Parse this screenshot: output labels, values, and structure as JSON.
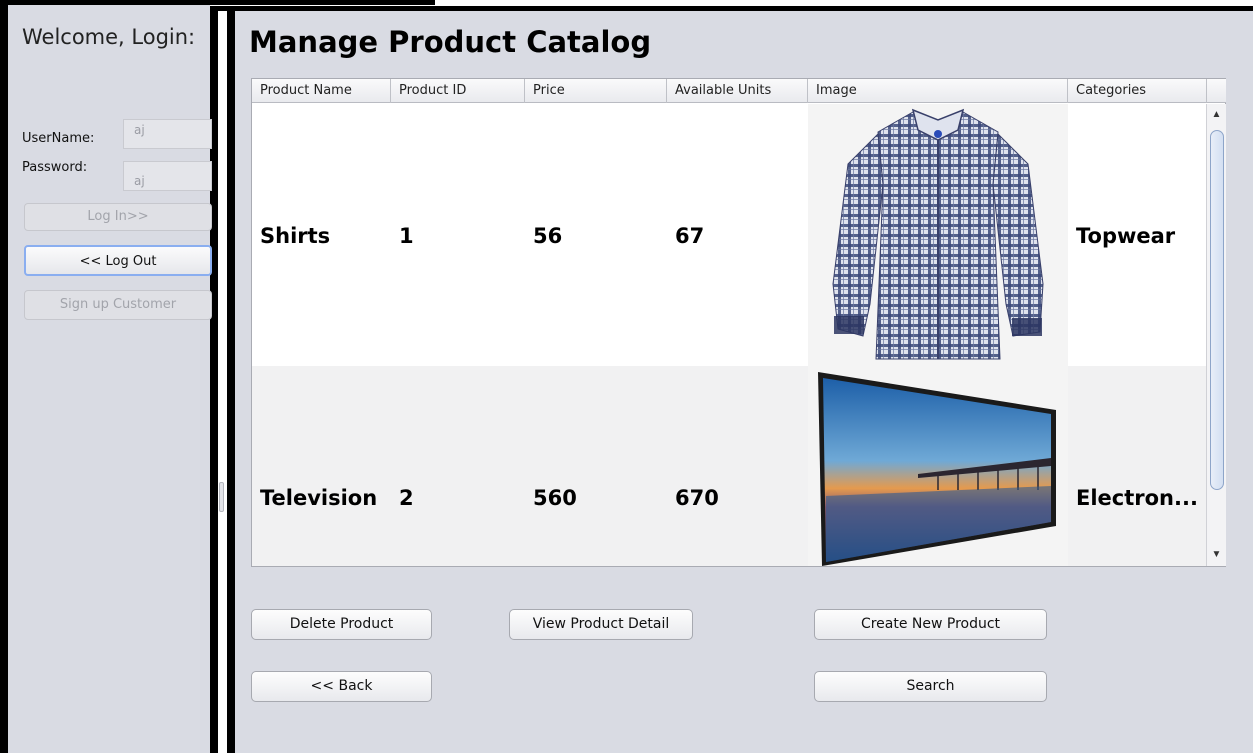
{
  "login_panel": {
    "welcome": "Welcome, Login:",
    "username_label": "UserName:",
    "password_label": "Password:",
    "username_value": "aj",
    "password_value": "aj",
    "login_button": "Log In>>",
    "logout_button": "<< Log Out",
    "signup_button": "Sign up Customer"
  },
  "main": {
    "title": "Manage Product Catalog",
    "table": {
      "headers": [
        "Product Name",
        "Product ID",
        "Price",
        "Available Units",
        "Image",
        "Categories"
      ],
      "rows": [
        {
          "name": "Shirts",
          "id": "1",
          "price": "56",
          "units": "67",
          "image": "shirt-image",
          "category": "Topwear"
        },
        {
          "name": "Television",
          "id": "2",
          "price": "560",
          "units": "670",
          "image": "television-image",
          "category": "Electron..."
        }
      ]
    },
    "buttons": {
      "delete": "Delete Product",
      "view": "View Product Detail",
      "create": "Create New Product",
      "back": "<< Back",
      "search": "Search"
    }
  },
  "colors": {
    "panel_bg": "#d9dbe3",
    "frame": "#000000",
    "focus_border": "#8aaef0"
  }
}
